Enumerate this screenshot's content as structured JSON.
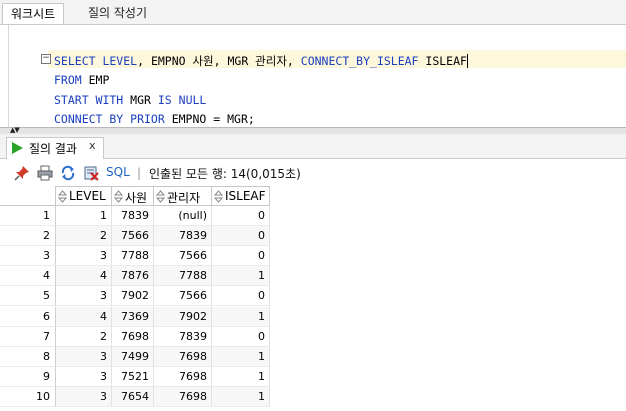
{
  "tabs": {
    "worksheet": "워크시트",
    "query_builder": "질의 작성기"
  },
  "editor": {
    "lines": [
      [
        {
          "t": "SELECT LEVEL",
          "k": "kw"
        },
        {
          "t": ", EMPNO 사원, MGR 관리자, ",
          "k": "id"
        },
        {
          "t": "CONNECT_BY_ISLEAF",
          "k": "kw"
        },
        {
          "t": " ISLEAF",
          "k": "id"
        }
      ],
      [
        {
          "t": "FROM",
          "k": "kw"
        },
        {
          "t": " EMP",
          "k": "id"
        }
      ],
      [
        {
          "t": "START WITH",
          "k": "kw"
        },
        {
          "t": " MGR ",
          "k": "id"
        },
        {
          "t": "IS NULL",
          "k": "kw"
        }
      ],
      [
        {
          "t": "CONNECT BY PRIOR",
          "k": "kw"
        },
        {
          "t": " EMPNO = MGR;",
          "k": "id"
        }
      ]
    ]
  },
  "result_tab": {
    "label": "질의 결과",
    "close": "x"
  },
  "toolbar": {
    "sql_label": "SQL",
    "separator": "|",
    "status": "인출된 모든 행: 14(0,015초)"
  },
  "grid": {
    "columns": [
      "LEVEL",
      "사원",
      "관리자",
      "ISLEAF"
    ],
    "rows": [
      [
        "1",
        "1",
        "7839",
        "(null)",
        "0"
      ],
      [
        "2",
        "2",
        "7566",
        "7839",
        "0"
      ],
      [
        "3",
        "3",
        "7788",
        "7566",
        "0"
      ],
      [
        "4",
        "4",
        "7876",
        "7788",
        "1"
      ],
      [
        "5",
        "3",
        "7902",
        "7566",
        "0"
      ],
      [
        "6",
        "4",
        "7369",
        "7902",
        "1"
      ],
      [
        "7",
        "2",
        "7698",
        "7839",
        "0"
      ],
      [
        "8",
        "3",
        "7499",
        "7698",
        "1"
      ],
      [
        "9",
        "3",
        "7521",
        "7698",
        "1"
      ],
      [
        "10",
        "3",
        "7654",
        "7698",
        "1"
      ]
    ]
  },
  "colors": {
    "keyword": "#1a3fbf",
    "sql_link": "#1e64c8",
    "run_green": "#2aa52a",
    "current_line": "#fdf7dc"
  }
}
